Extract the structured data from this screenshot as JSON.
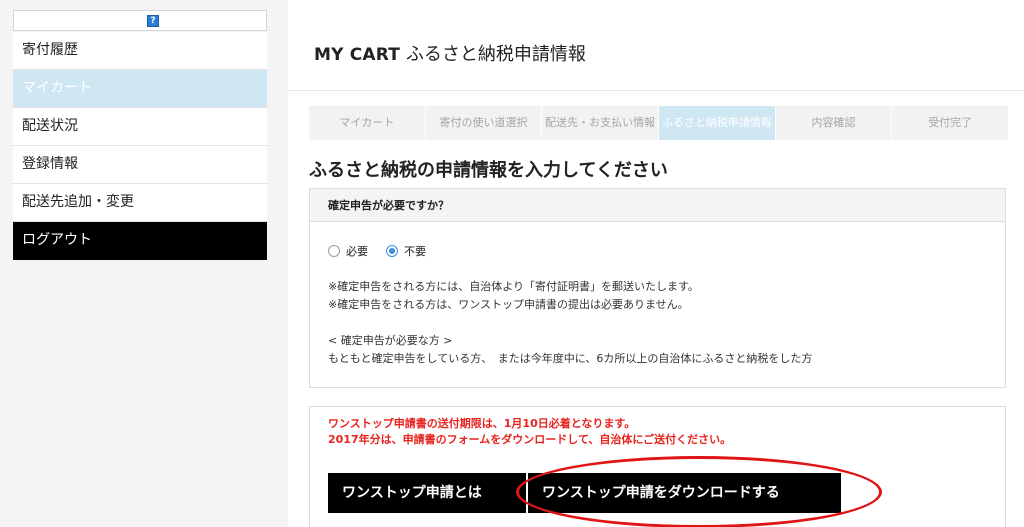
{
  "sidebar": {
    "help_icon": "?",
    "items": [
      {
        "label": "寄付履歴"
      },
      {
        "label": "マイカート"
      },
      {
        "label": "配送状況"
      },
      {
        "label": "登録情報"
      },
      {
        "label": "配送先追加・変更"
      },
      {
        "label": "ログアウト"
      }
    ]
  },
  "header": {
    "title_en": "MY CART",
    "title_jp": "ふるさと納税申請情報"
  },
  "steps": [
    {
      "label": "マイカート"
    },
    {
      "label": "寄付の使い道選択"
    },
    {
      "label": "配送先・お支払い情報"
    },
    {
      "label": "ふるさと納税申請情報"
    },
    {
      "label": "内容確認"
    },
    {
      "label": "受付完了"
    }
  ],
  "main": {
    "heading": "ふるさと納税の申請情報を入力してください",
    "question": "確定申告が必要ですか？",
    "options": [
      {
        "label": "必要"
      },
      {
        "label": "不要"
      }
    ],
    "notes": [
      "※確定申告をされる方には、自治体より「寄付証明書」を郵送いたします。",
      "※確定申告をされる方は、ワンストップ申請書の提出は必要ありません。",
      "< 確定申告が必要な方 >",
      "もともと確定申告をしている方、　または今年度中に、6カ所以上の自治体にふるさと納税をした方"
    ],
    "red_notice": [
      "ワンストップ申請書の送付期限は、1月10日必着となります。",
      "2017年分は、申請書のフォームをダウンロードして、自治体にご送付ください。"
    ],
    "btn_about": "ワンストップ申請とは",
    "btn_download": "ワンストップ申請をダウンロードする"
  },
  "colors": {
    "accent": "#cfe7f3",
    "notice_red": "#e8231f",
    "button_bg": "#000000",
    "highlight_ring": "#e01414",
    "radio_checked": "#3b8ed8"
  }
}
